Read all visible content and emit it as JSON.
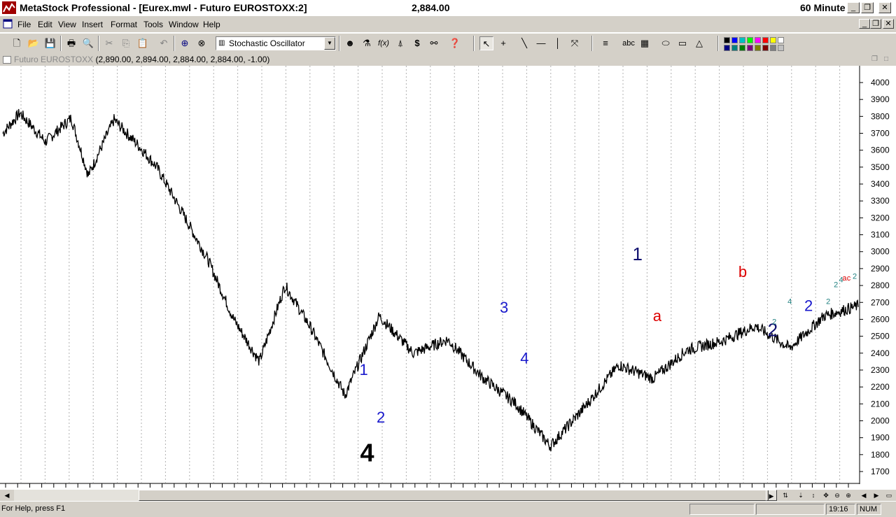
{
  "app": {
    "title": "MetaStock Professional - [Eurex.mwl - Futuro EUROSTOXX:2]",
    "last_price": "2,884.00",
    "periodicity": "60 Minute"
  },
  "menu": [
    "File",
    "Edit",
    "View",
    "Insert",
    "Format",
    "Tools",
    "Window",
    "Help"
  ],
  "toolbar": {
    "indicator_selected": "Stochastic Oscillator",
    "text_tool_label": "abc",
    "icons": [
      "new-icon",
      "open-icon",
      "save-icon",
      "print-icon",
      "print-preview-icon",
      "cut-icon",
      "copy-icon",
      "paste-icon",
      "undo-icon",
      "crosshair-icon",
      "zoom-icon",
      "indicator-icon",
      "expert-icon",
      "formula-icon",
      "system-tester-icon",
      "dollar-icon",
      "explorer-icon",
      "help-pointer-icon",
      "pointer-icon",
      "cross-icon",
      "trendline-icon",
      "horizontal-line-icon",
      "vertical-line-icon",
      "cycle-icon",
      "fib-icon",
      "text-icon",
      "grid-icon",
      "ellipse-icon",
      "rectangle-icon",
      "triangle-icon"
    ],
    "palette_colors": [
      "#000000",
      "#0000ff",
      "#00c0c0",
      "#00ff00",
      "#ff00ff",
      "#ff0000",
      "#ffff00",
      "#ffffff",
      "#000080",
      "#008080",
      "#008000",
      "#800080",
      "#808000",
      "#800000",
      "#808080",
      "#c0c0c0"
    ]
  },
  "chart": {
    "security_label": "Futuro EUROSTOXX",
    "ohlc_label": "(2,890.00, 2,894.00, 2,884.00, 2,884.00, -1.00)",
    "y_axis_ticks": [
      "4000",
      "3900",
      "3800",
      "3700",
      "3600",
      "3500",
      "3400",
      "3300",
      "3200",
      "3100",
      "3000",
      "2900",
      "2800",
      "2700",
      "2600",
      "2500",
      "2400",
      "2300",
      "2200",
      "2100",
      "2000",
      "1900",
      "1800",
      "1700"
    ],
    "wave_labels": [
      {
        "text": "4",
        "color": "#000000",
        "size": "huge"
      },
      {
        "text": "1",
        "color": "#1a1acc",
        "size": "medium"
      },
      {
        "text": "2",
        "color": "#1a1acc",
        "size": "medium"
      },
      {
        "text": "3",
        "color": "#1a1acc",
        "size": "medium"
      },
      {
        "text": "4",
        "color": "#1a1acc",
        "size": "medium"
      },
      {
        "text": "1",
        "color": "#101070",
        "size": "large"
      },
      {
        "text": "a",
        "color": "#dd0000",
        "size": "medium"
      },
      {
        "text": "b",
        "color": "#dd0000",
        "size": "medium"
      },
      {
        "text": "2",
        "color": "#101070",
        "size": "large"
      },
      {
        "text": "2",
        "color": "#1a1acc",
        "size": "medium"
      },
      {
        "text": "2",
        "color": "#208080",
        "size": "small"
      },
      {
        "text": "4",
        "color": "#208080",
        "size": "small"
      },
      {
        "text": "2",
        "color": "#208080",
        "size": "small"
      },
      {
        "text": "2",
        "color": "#208080",
        "size": "small"
      },
      {
        "text": "4",
        "color": "#208080",
        "size": "small"
      },
      {
        "text": "a",
        "color": "#dd0000",
        "size": "small"
      },
      {
        "text": "c",
        "color": "#dd0000",
        "size": "small"
      },
      {
        "text": "2",
        "color": "#208080",
        "size": "small"
      }
    ]
  },
  "chart_data": {
    "type": "line",
    "title": "Futuro EUROSTOXX",
    "ylim": [
      1650,
      4050
    ],
    "grid": "vertical dotted",
    "x": [
      0,
      2,
      5,
      8,
      10,
      13,
      16,
      18,
      21,
      24,
      27,
      30,
      33,
      36,
      40,
      44,
      48,
      52,
      56,
      60,
      64,
      68,
      72,
      76,
      80,
      84,
      88,
      92,
      96,
      100
    ],
    "values": [
      3700,
      3820,
      3650,
      3790,
      3450,
      3780,
      3620,
      3500,
      3230,
      2950,
      2600,
      2350,
      2800,
      2550,
      2150,
      2620,
      2400,
      2480,
      2260,
      2100,
      1850,
      2080,
      2330,
      2250,
      2420,
      2470,
      2560,
      2430,
      2620,
      2680
    ]
  },
  "statusbar": {
    "help_text": "For Help, press F1",
    "time": "19:16",
    "num": "NUM"
  }
}
